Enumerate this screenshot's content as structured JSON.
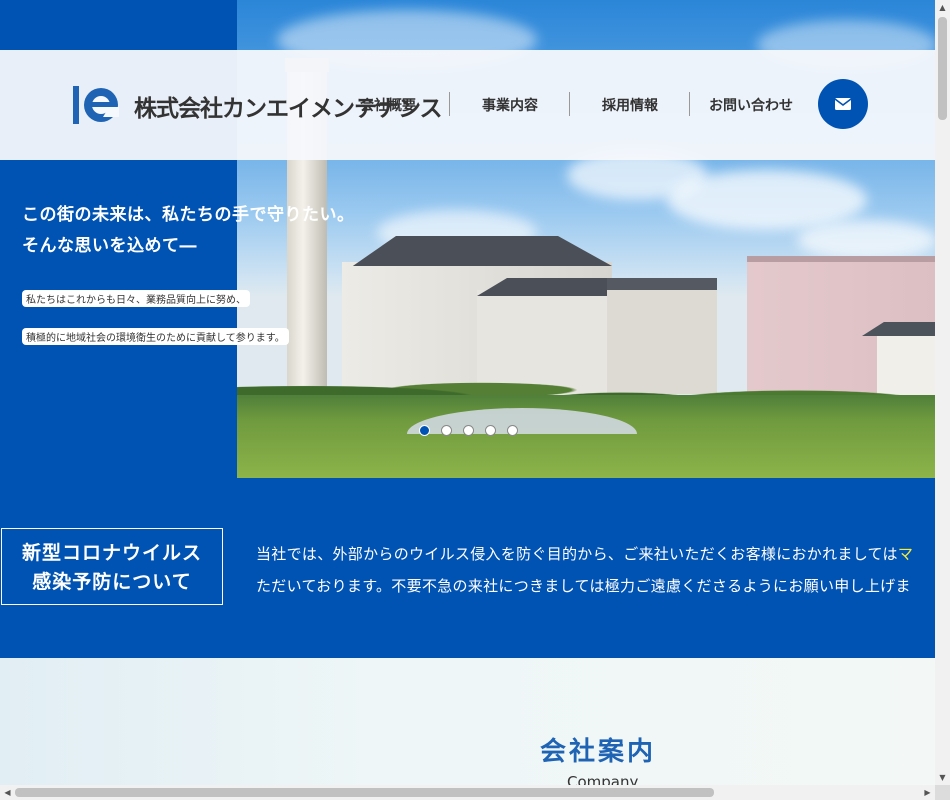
{
  "header": {
    "company_name": "株式会社カンエイメンテナンス",
    "nav": [
      "会社概要",
      "事業内容",
      "採用情報",
      "お問い合わせ"
    ],
    "mail_icon": "envelope-icon"
  },
  "hero": {
    "tagline_1": "この街の未来は、私たちの手で守りたい。",
    "tagline_2": "そんな思いを込めて―",
    "body_1": "私たちはこれからも日々、業務品質向上に努め、",
    "body_2": "積極的に地域社会の環境衛生のために貢献して参ります。",
    "slide_count": 5,
    "active_slide": 1
  },
  "notice": {
    "title_1": "新型コロナウイルス",
    "title_2": "感染予防について",
    "line_1": "当社では、外部からのウイルス侵入を防ぐ目的から、ご来社いただくお客様におかれましては",
    "line_1_highlight": "マ",
    "line_2": "ただいております。不要不急の来社につきましては極力ご遠慮くださるようにお願い申し上げま"
  },
  "company_section": {
    "title": "会社案内",
    "subtitle": "Company"
  },
  "colors": {
    "brand_blue": "#0153b3",
    "highlight_yellow": "#f7ee3a"
  }
}
